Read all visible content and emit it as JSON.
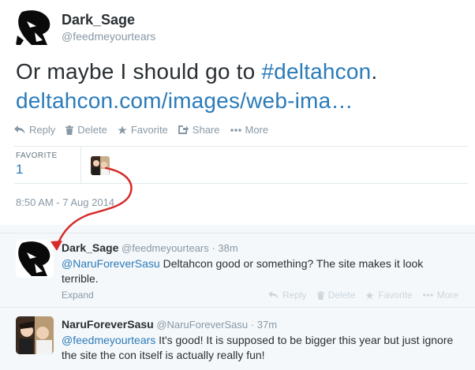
{
  "tweet": {
    "author_name": "Dark_Sage",
    "author_handle": "@feedmeyourtears",
    "text_plain": "Or maybe I should go to ",
    "hashtag": "#deltahcon",
    "text_end": ".",
    "link": "deltahcon.com/images/web-ima…",
    "actions": {
      "reply": "Reply",
      "delete": "Delete",
      "favorite": "Favorite",
      "share": "Share",
      "more": "More"
    },
    "stats": {
      "favorite_label": "FAVORITE",
      "favorite_count": "1"
    },
    "timestamp": "8:50 AM - 7 Aug 2014"
  },
  "replies": [
    {
      "name": "Dark_Sage",
      "handle": "@feedmeyourtears",
      "time": "38m",
      "mention": "@NaruForeverSasu",
      "text": " Deltahcon good or something? The site makes it look terrible.",
      "expand": "Expand",
      "actions": {
        "reply": "Reply",
        "delete": "Delete",
        "favorite": "Favorite",
        "more": "More"
      }
    },
    {
      "name": "NaruForeverSasu",
      "handle": "@NaruForeverSasu",
      "time": "37m",
      "mention": "@feedmeyourtears",
      "text": " It's good! It is supposed to be bigger this year but just ignore the site the con itself is actually really fun!"
    }
  ],
  "colors": {
    "link": "#2b7bb9",
    "muted": "#8899a6",
    "text": "#292f33",
    "annotation_arrow": "#d62b2b"
  },
  "icons": [
    "reply-icon",
    "trash-icon",
    "star-icon",
    "share-icon",
    "more-dots-icon"
  ]
}
